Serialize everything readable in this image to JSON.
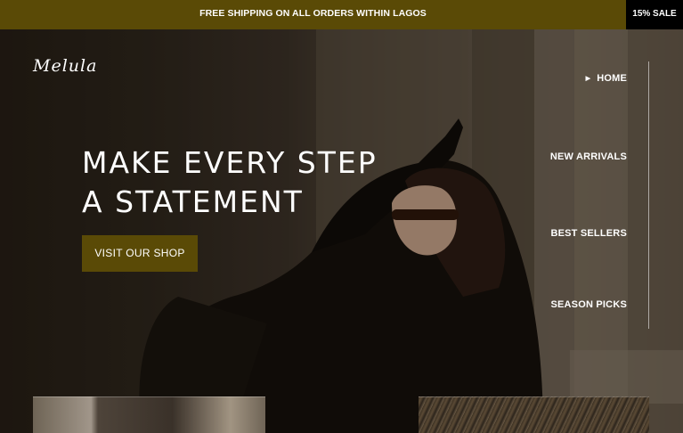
{
  "announcement_bar": {
    "message": "FREE SHIPPING ON ALL ORDERS WITHIN LAGOS",
    "sale_badge": "15% SALE",
    "background_color": "#5a4a06"
  },
  "brand": {
    "logo_text": "Melula"
  },
  "hero": {
    "headline_line1": "MAKE EVERY STEP",
    "headline_line2": "A STATEMENT",
    "cta_label": "VISIT OUR SHOP",
    "cta_color": "#5a4a06"
  },
  "side_nav": {
    "items": [
      {
        "label": "HOME",
        "active": true,
        "marker_icon": "caret-right-icon"
      },
      {
        "label": "NEW ARRIVALS",
        "active": false
      },
      {
        "label": "BEST SELLERS",
        "active": false
      },
      {
        "label": "SEASON PICKS",
        "active": false
      }
    ]
  }
}
